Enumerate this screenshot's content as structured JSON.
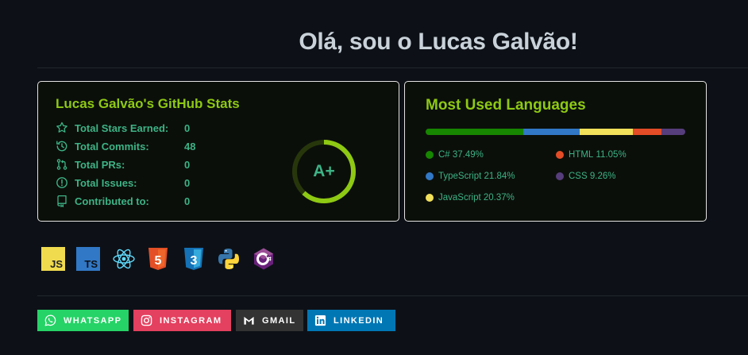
{
  "heading": "Olá, sou o Lucas Galvão!",
  "stats_card": {
    "title": "Lucas Galvão's GitHub Stats",
    "rows": [
      {
        "label": "Total Stars Earned:",
        "value": "0",
        "icon": "star-icon"
      },
      {
        "label": "Total Commits:",
        "value": "48",
        "icon": "history-icon"
      },
      {
        "label": "Total PRs:",
        "value": "0",
        "icon": "pull-request-icon"
      },
      {
        "label": "Total Issues:",
        "value": "0",
        "icon": "issue-icon"
      },
      {
        "label": "Contributed to:",
        "value": "0",
        "icon": "repo-icon"
      }
    ],
    "rank": "A+",
    "rank_progress": 0.62,
    "colors": {
      "title": "#8ec913",
      "text": "#3db386",
      "ring": "#8ec913"
    }
  },
  "languages_card": {
    "title": "Most Used Languages",
    "languages": [
      {
        "name": "C#",
        "percent_label": "37.49%",
        "percent": 37.49,
        "color": "#178600"
      },
      {
        "name": "TypeScript",
        "percent_label": "21.84%",
        "percent": 21.84,
        "color": "#3178c6"
      },
      {
        "name": "JavaScript",
        "percent_label": "20.37%",
        "percent": 20.37,
        "color": "#f1e05a"
      },
      {
        "name": "HTML",
        "percent_label": "11.05%",
        "percent": 11.05,
        "color": "#e34c26"
      },
      {
        "name": "CSS",
        "percent_label": "9.26%",
        "percent": 9.26,
        "color": "#563d7c"
      }
    ]
  },
  "tech_icons": [
    "javascript-icon",
    "typescript-icon",
    "react-icon",
    "html5-icon",
    "css3-icon",
    "python-icon",
    "csharp-icon"
  ],
  "tech_labels": {
    "js": "JS",
    "ts": "TS",
    "html": "5",
    "css": "3"
  },
  "social_badges": [
    {
      "label": "WHATSAPP",
      "icon": "whatsapp-icon",
      "color": "#25d366"
    },
    {
      "label": "INSTAGRAM",
      "icon": "instagram-icon",
      "color": "#e4405f"
    },
    {
      "label": "GMAIL",
      "icon": "gmail-icon",
      "color": "#333333"
    },
    {
      "label": "LINKEDIN",
      "icon": "linkedin-icon",
      "color": "#0077b5"
    }
  ]
}
